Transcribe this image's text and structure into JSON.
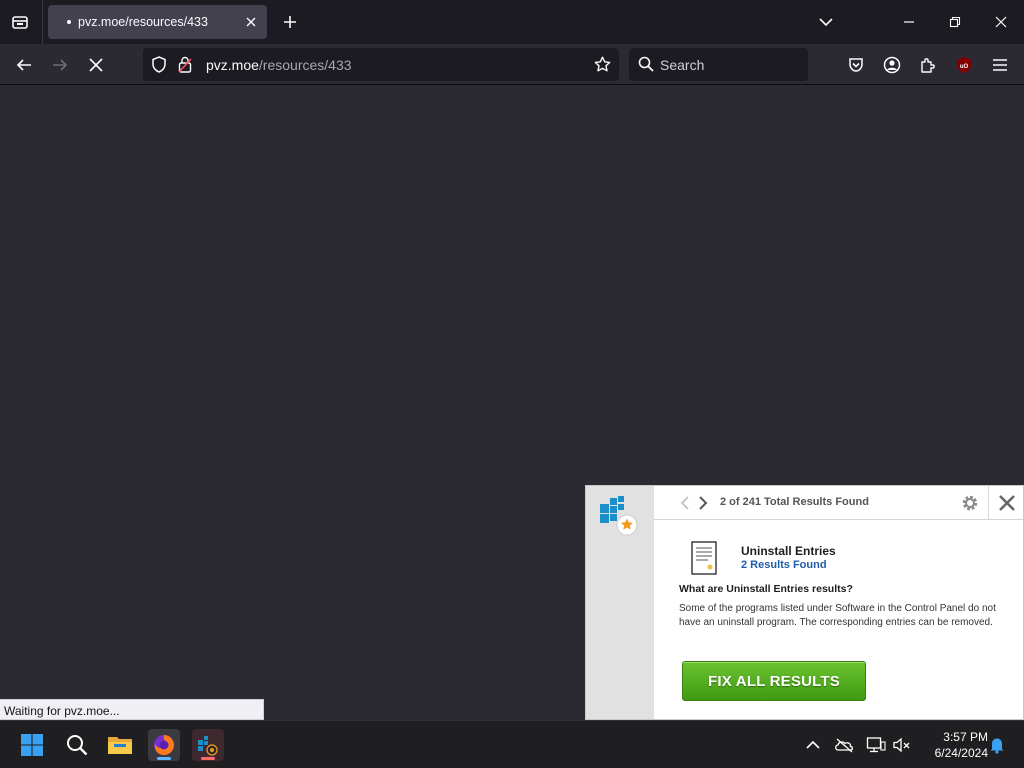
{
  "browser": {
    "tab": {
      "title": "pvz.moe/resources/433"
    },
    "url": {
      "host": "pvz.moe",
      "path": "/resources/433"
    },
    "search_placeholder": "Search",
    "status_text": "Waiting for pvz.moe..."
  },
  "popup": {
    "result_count": "2 of 241 Total Results Found",
    "entry_title": "Uninstall Entries",
    "entry_count": "2 Results Found",
    "question": "What are Uninstall Entries results?",
    "description": "Some of the programs listed under Software in the Control Panel do not have an uninstall program. The corresponding entries can be removed.",
    "fix_button": "FIX ALL RESULTS",
    "colors": {
      "button": "#4caf1e",
      "link": "#1f5ea8",
      "logo": "#1b8fc9"
    }
  },
  "taskbar": {
    "time": "3:57 PM",
    "date": "6/24/2024",
    "apps": [
      "start-icon",
      "search-icon",
      "file-explorer-icon",
      "firefox-icon",
      "cleaner-app-icon"
    ]
  }
}
